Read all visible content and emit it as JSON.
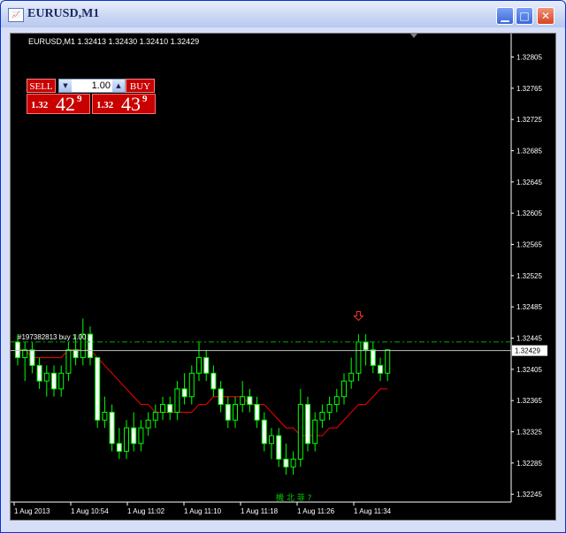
{
  "window": {
    "title": "EURUSD,M1",
    "icons": {
      "app": "chart-icon",
      "minimize": "minimize-icon",
      "maximize": "maximize-icon",
      "close": "close-icon"
    }
  },
  "chart": {
    "header": "EURUSD,M1  1.32413 1.32430 1.32410 1.32429",
    "trade_panel": {
      "sell_label": "SELL",
      "buy_label": "BUY",
      "lot_value": "1.00",
      "sell_quote": {
        "big": "1.32",
        "pips": "42",
        "sup": "9"
      },
      "buy_quote": {
        "big": "1.32",
        "pips": "43",
        "sup": "9"
      }
    },
    "order_line_label": "#197382813 buy 1.00",
    "current_price_label": "1.32429",
    "bottom_label": "機 北 菲 ?",
    "colors": {
      "bg": "#000000",
      "candle": "#00ff00",
      "ma": "#ff0000",
      "axis_text": "#ffffff",
      "order_line": "#00aa00",
      "sell_arrow": "#ff3333"
    }
  },
  "chart_data": {
    "type": "candlestick",
    "y_ticks": [
      "1.32805",
      "1.32765",
      "1.32725",
      "1.32685",
      "1.32645",
      "1.32605",
      "1.32565",
      "1.32525",
      "1.32485",
      "1.32445",
      "1.32405",
      "1.32365",
      "1.32325",
      "1.32285",
      "1.32245"
    ],
    "x_ticks": [
      "1 Aug 2013",
      "1 Aug 10:54",
      "1 Aug 11:02",
      "1 Aug 11:10",
      "1 Aug 11:18",
      "1 Aug 11:26",
      "1 Aug 11:34"
    ],
    "ylim": [
      1.32235,
      1.32835
    ],
    "order_line_price": 1.3244,
    "current_price": 1.32429,
    "candles": [
      [
        1.3244,
        1.3245,
        1.3241,
        1.3242
      ],
      [
        1.3242,
        1.3244,
        1.3239,
        1.3243
      ],
      [
        1.3243,
        1.3244,
        1.324,
        1.3241
      ],
      [
        1.3241,
        1.3242,
        1.3238,
        1.3239
      ],
      [
        1.3239,
        1.3241,
        1.3237,
        1.324
      ],
      [
        1.324,
        1.3241,
        1.3237,
        1.3238
      ],
      [
        1.3238,
        1.3241,
        1.3237,
        1.324
      ],
      [
        1.324,
        1.3244,
        1.3239,
        1.3243
      ],
      [
        1.3243,
        1.3245,
        1.3241,
        1.3242
      ],
      [
        1.3242,
        1.3247,
        1.3241,
        1.3245
      ],
      [
        1.3245,
        1.3246,
        1.3241,
        1.3242
      ],
      [
        1.3242,
        1.3242,
        1.3233,
        1.3234
      ],
      [
        1.3234,
        1.3237,
        1.3233,
        1.3235
      ],
      [
        1.3235,
        1.3236,
        1.323,
        1.3231
      ],
      [
        1.3231,
        1.3233,
        1.3229,
        1.323
      ],
      [
        1.323,
        1.3234,
        1.3229,
        1.3233
      ],
      [
        1.3233,
        1.3235,
        1.323,
        1.3231
      ],
      [
        1.3231,
        1.3234,
        1.323,
        1.3233
      ],
      [
        1.3233,
        1.3235,
        1.3232,
        1.3234
      ],
      [
        1.3234,
        1.3236,
        1.3233,
        1.3235
      ],
      [
        1.3235,
        1.3237,
        1.3234,
        1.3236
      ],
      [
        1.3236,
        1.3237,
        1.3234,
        1.3235
      ],
      [
        1.3235,
        1.3239,
        1.3234,
        1.3238
      ],
      [
        1.3238,
        1.324,
        1.3236,
        1.3237
      ],
      [
        1.3237,
        1.3241,
        1.3236,
        1.324
      ],
      [
        1.324,
        1.3244,
        1.3239,
        1.3242
      ],
      [
        1.3242,
        1.3243,
        1.3239,
        1.324
      ],
      [
        1.324,
        1.3241,
        1.3237,
        1.3238
      ],
      [
        1.3238,
        1.3239,
        1.3235,
        1.3236
      ],
      [
        1.3236,
        1.3237,
        1.3233,
        1.3234
      ],
      [
        1.3234,
        1.3237,
        1.3233,
        1.3236
      ],
      [
        1.3236,
        1.3239,
        1.3235,
        1.3237
      ],
      [
        1.3237,
        1.3238,
        1.3235,
        1.3236
      ],
      [
        1.3236,
        1.3237,
        1.3233,
        1.3234
      ],
      [
        1.3234,
        1.3235,
        1.323,
        1.3231
      ],
      [
        1.3231,
        1.3233,
        1.3229,
        1.3232
      ],
      [
        1.3232,
        1.3233,
        1.3228,
        1.3229
      ],
      [
        1.3229,
        1.3231,
        1.3227,
        1.3228
      ],
      [
        1.3228,
        1.323,
        1.3227,
        1.3229
      ],
      [
        1.3229,
        1.3238,
        1.3228,
        1.3236
      ],
      [
        1.3236,
        1.3237,
        1.323,
        1.3231
      ],
      [
        1.3231,
        1.3235,
        1.323,
        1.3234
      ],
      [
        1.3234,
        1.3236,
        1.3233,
        1.3235
      ],
      [
        1.3235,
        1.3237,
        1.3234,
        1.3236
      ],
      [
        1.3236,
        1.3238,
        1.3235,
        1.3237
      ],
      [
        1.3237,
        1.324,
        1.3236,
        1.3239
      ],
      [
        1.3239,
        1.3242,
        1.3238,
        1.324
      ],
      [
        1.324,
        1.3245,
        1.3239,
        1.3244
      ],
      [
        1.3244,
        1.3245,
        1.3241,
        1.3243
      ],
      [
        1.3243,
        1.3244,
        1.324,
        1.3241
      ],
      [
        1.3241,
        1.3242,
        1.3239,
        1.324
      ],
      [
        1.324,
        1.3243,
        1.3239,
        1.3243
      ]
    ],
    "ma": [
      1.3243,
      1.3243,
      1.3242,
      1.3242,
      1.3242,
      1.3242,
      1.3242,
      1.3243,
      1.3243,
      1.3243,
      1.3243,
      1.3242,
      1.3241,
      1.324,
      1.3239,
      1.3238,
      1.3237,
      1.3236,
      1.3236,
      1.3235,
      1.3235,
      1.3235,
      1.3235,
      1.3235,
      1.3235,
      1.3236,
      1.3236,
      1.3237,
      1.3237,
      1.3237,
      1.3237,
      1.3237,
      1.3236,
      1.3236,
      1.3236,
      1.3235,
      1.3234,
      1.3233,
      1.3233,
      1.3232,
      1.3232,
      1.3232,
      1.3232,
      1.3233,
      1.3233,
      1.3234,
      1.3235,
      1.3236,
      1.3236,
      1.3237,
      1.3238,
      1.3238
    ]
  }
}
